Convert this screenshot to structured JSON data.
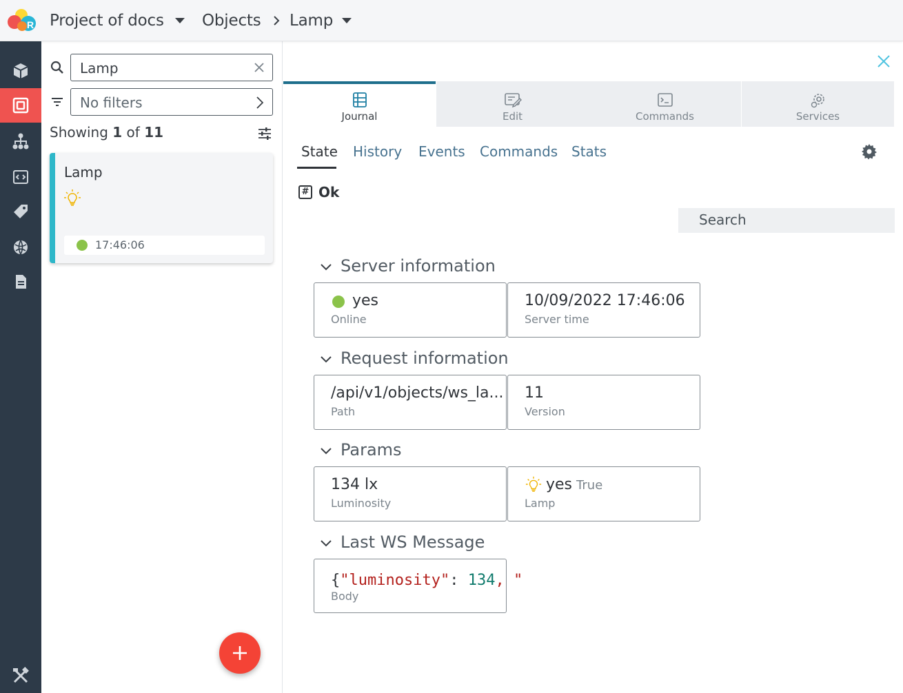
{
  "header": {
    "project": "Project of docs",
    "section": "Objects",
    "object": "Lamp"
  },
  "colors": {
    "accent_red": "#ef5350",
    "card_bar": "#2eb7c9",
    "online_green": "#8bc34a",
    "rail_bg": "#2d3a48",
    "link_blue": "#47728f"
  },
  "rail": {
    "items": [
      {
        "icon": "cube-icon"
      },
      {
        "icon": "object-icon",
        "active": true
      },
      {
        "icon": "hierarchy-icon"
      },
      {
        "icon": "code-window-icon"
      },
      {
        "icon": "tag-icon"
      },
      {
        "icon": "globe-icon"
      },
      {
        "icon": "document-icon"
      }
    ],
    "bottom_icon": "tools-icon"
  },
  "list": {
    "search_value": "Lamp",
    "filter_value": "No filters",
    "showing_prefix": "Showing",
    "showing_count": "1",
    "showing_of": "of",
    "showing_total": "11",
    "card": {
      "title": "Lamp",
      "time": "17:46:06"
    }
  },
  "detail": {
    "tabs": [
      {
        "label": "Journal",
        "icon": "journal-icon",
        "active": true
      },
      {
        "label": "Edit",
        "icon": "edit-icon"
      },
      {
        "label": "Commands",
        "icon": "terminal-icon"
      },
      {
        "label": "Services",
        "icon": "services-gear-icon"
      }
    ],
    "subtabs": [
      "State",
      "History",
      "Events",
      "Commands",
      "Stats"
    ],
    "status": "Ok",
    "search_placeholder": "Search",
    "sections": {
      "server": {
        "title": "Server information",
        "online_value": "yes",
        "online_label": "Online",
        "time_value": "10/09/2022 17:46:06",
        "time_label": "Server time"
      },
      "request": {
        "title": "Request information",
        "path_value": "/api/v1/objects/ws_la...",
        "path_label": "Path",
        "version_value": "11",
        "version_label": "Version"
      },
      "params": {
        "title": "Params",
        "lux_value": "134 lx",
        "lux_label": "Luminosity",
        "lamp_value": "yes",
        "lamp_state": "True",
        "lamp_label": "Lamp"
      },
      "ws": {
        "title": "Last WS Message",
        "body_open": "{",
        "body_key": "\"luminosity\"",
        "body_colon": ": ",
        "body_num": "134",
        "body_tail": ", \"",
        "body_label": "Body"
      }
    }
  }
}
